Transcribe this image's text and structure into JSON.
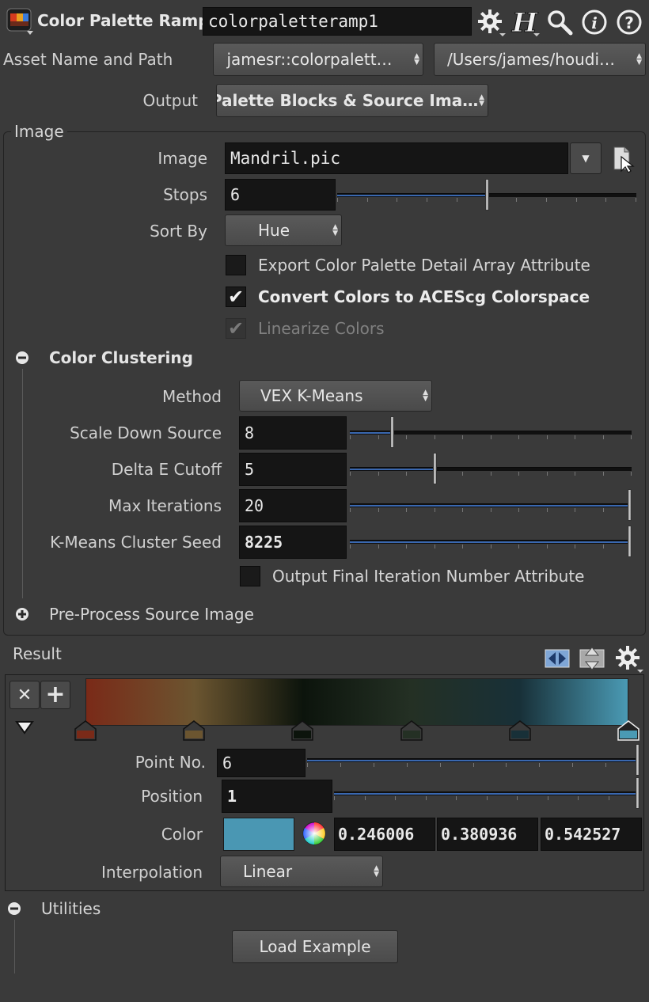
{
  "header": {
    "node_type": "Color Palette Ramp",
    "node_name": "colorpaletteramp1",
    "icons": [
      "gear-icon",
      "houdini-h-icon",
      "search-icon",
      "info-icon",
      "help-icon"
    ]
  },
  "asset": {
    "label": "Asset Name and Path",
    "name": "jamesr::colorpalett…",
    "path": "/Users/james/houdi…"
  },
  "output": {
    "label": "Output",
    "value": "Palette Blocks & Source Ima…"
  },
  "image_section": {
    "title": "Image",
    "image_label": "Image",
    "image_value": "Mandril.pic",
    "stops_label": "Stops",
    "stops_value": "6",
    "stops_level": 0.5,
    "sortby_label": "Sort By",
    "sortby_value": "Hue",
    "export_label": "Export Color Palette Detail Array Attribute",
    "export_checked": false,
    "convert_label": "Convert Colors to ACEScg Colorspace",
    "convert_checked": true,
    "linearize_label": "Linearize Colors",
    "linearize_checked": true
  },
  "clustering": {
    "title": "Color Clustering",
    "method_label": "Method",
    "method_value": "VEX K-Means",
    "scale_label": "Scale Down Source",
    "scale_value": "8",
    "scale_level": 0.15,
    "delta_label": "Delta E Cutoff",
    "delta_value": "5",
    "delta_level": 0.3,
    "maxiter_label": "Max Iterations",
    "maxiter_value": "20",
    "maxiter_level": 1.0,
    "seed_label": "K-Means Cluster Seed",
    "seed_value": "8225",
    "seed_level": 1.0,
    "final_iter_label": "Output Final Iteration Number Attribute",
    "final_iter_checked": false
  },
  "preprocess": {
    "title": "Pre-Process Source Image"
  },
  "result": {
    "title": "Result",
    "ramp_colors": [
      "#7a2a18",
      "#6b5530",
      "#0c140c",
      "#243024",
      "#183038",
      "#4a9ab4"
    ],
    "stop_colors": [
      "#7a2a18",
      "#6b5530",
      "#0c140c",
      "#243024",
      "#183038",
      "#4a9ab4"
    ],
    "pointno_label": "Point No.",
    "pointno_value": "6",
    "position_label": "Position",
    "position_value": "1",
    "color_label": "Color",
    "color_swatch": "#4a97b3",
    "color_r": "0.246006",
    "color_g": "0.380936",
    "color_b": "0.542527",
    "interp_label": "Interpolation",
    "interp_value": "Linear"
  },
  "utilities": {
    "title": "Utilities",
    "load_example": "Load Example"
  }
}
